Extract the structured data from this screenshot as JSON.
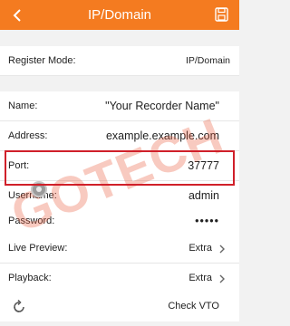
{
  "header": {
    "title": "IP/Domain",
    "back_icon": "chevron-left-icon",
    "save_icon": "save-icon",
    "color": "#f47b20"
  },
  "fields": {
    "register_mode": {
      "label": "Register Mode:",
      "value": "IP/Domain"
    },
    "name": {
      "label": "Name:",
      "value": "\"Your Recorder Name\""
    },
    "address": {
      "label": "Address:",
      "value": "example.example.com"
    },
    "port": {
      "label": "Port:",
      "value": "37777"
    },
    "username": {
      "label": "Username:",
      "value": "admin"
    },
    "password": {
      "label": "Password:",
      "value": "•••••"
    },
    "live_preview": {
      "label": "Live Preview:",
      "value": "Extra"
    },
    "playback": {
      "label": "Playback:",
      "value": "Extra"
    }
  },
  "vto": {
    "label": "Check VTO",
    "icon": "refresh-icon"
  },
  "watermark": {
    "text": "GOTECH"
  },
  "highlight_color": "#d0202a"
}
